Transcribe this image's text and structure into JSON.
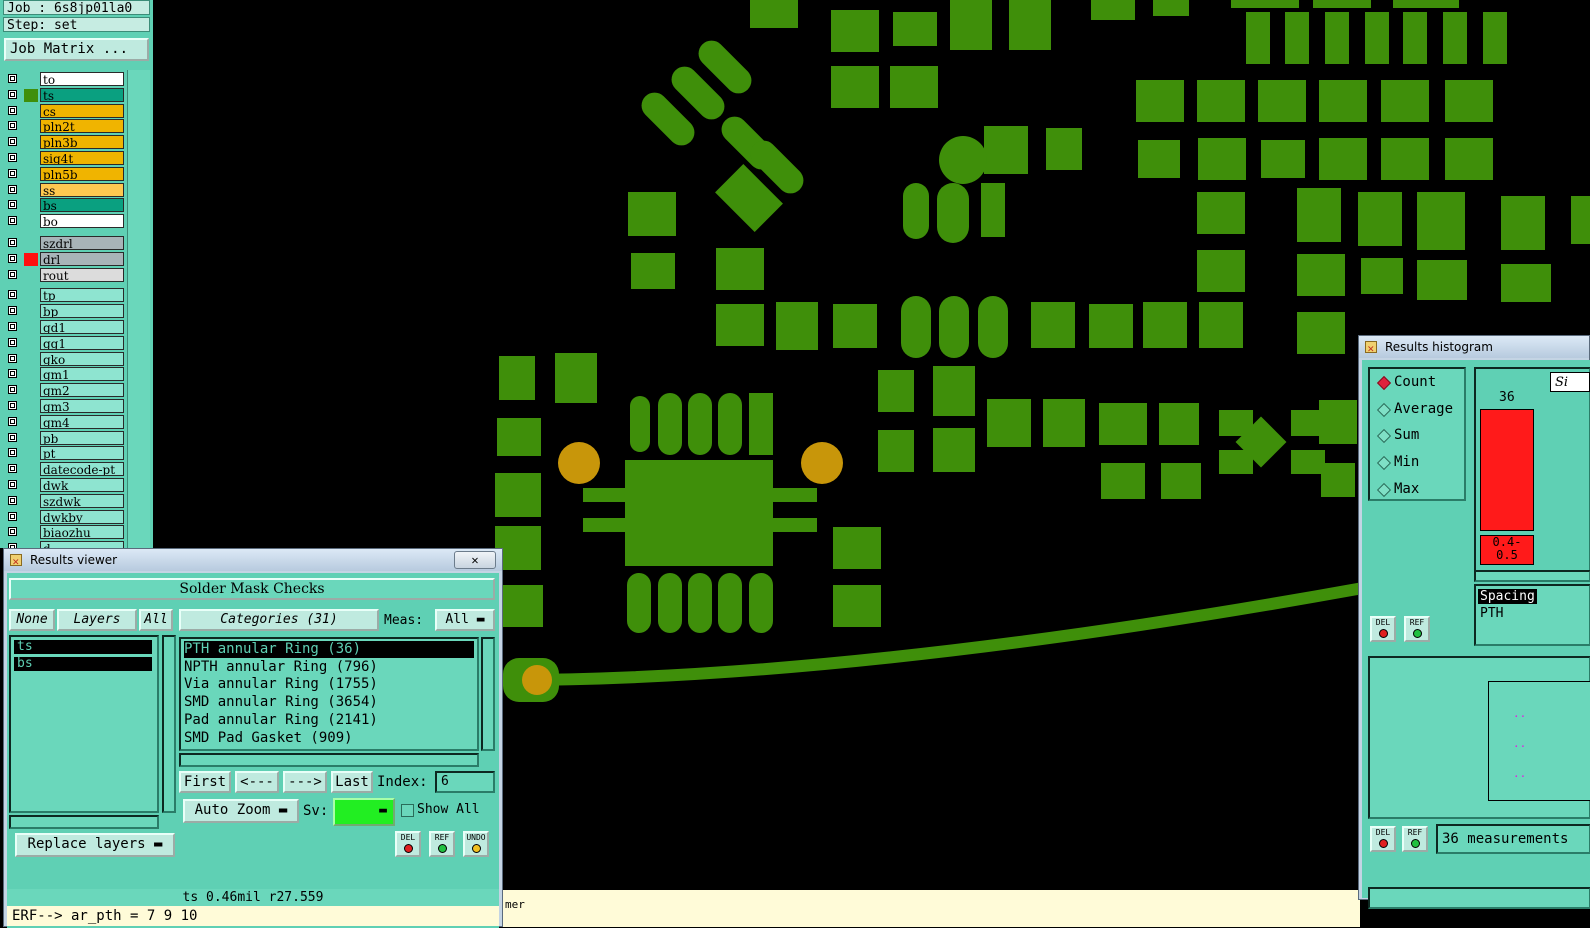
{
  "job": {
    "job_line": "Job : 6s8jp01la0",
    "step_line": "Step: set",
    "matrix_button": "Job Matrix ..."
  },
  "layers": [
    {
      "name": "to",
      "color": "#ffffff"
    },
    {
      "name": "ts",
      "color": "#0aa080",
      "active": true
    },
    {
      "name": "cs",
      "color": "#f0b400"
    },
    {
      "name": "pln2t",
      "color": "#f0b400"
    },
    {
      "name": "pln3b",
      "color": "#f0b400"
    },
    {
      "name": "sig4t",
      "color": "#f0b400"
    },
    {
      "name": "pln5b",
      "color": "#f0b400"
    },
    {
      "name": "ss",
      "color": "#ffc850"
    },
    {
      "name": "bs",
      "color": "#0aa080"
    },
    {
      "name": "bo",
      "color": "#ffffff"
    },
    {
      "name": "szdrl",
      "color": "#a8b4b8"
    },
    {
      "name": "drl",
      "color": "#a8b4b8",
      "swatch": "#ff1010"
    },
    {
      "name": "rout",
      "color": "#dcdcdc"
    },
    {
      "name": "tp",
      "color": "#8ee4d0"
    },
    {
      "name": "bp",
      "color": "#8ee4d0"
    },
    {
      "name": "gd1",
      "color": "#8ee4d0"
    },
    {
      "name": "gg1",
      "color": "#8ee4d0"
    },
    {
      "name": "gko",
      "color": "#8ee4d0"
    },
    {
      "name": "gm1",
      "color": "#8ee4d0"
    },
    {
      "name": "gm2",
      "color": "#8ee4d0"
    },
    {
      "name": "gm3",
      "color": "#8ee4d0"
    },
    {
      "name": "gm4",
      "color": "#8ee4d0"
    },
    {
      "name": "pb",
      "color": "#8ee4d0"
    },
    {
      "name": "pt",
      "color": "#8ee4d0"
    },
    {
      "name": "datecode-pt",
      "color": "#8ee4d0"
    },
    {
      "name": "dwk",
      "color": "#8ee4d0"
    },
    {
      "name": "szdwk",
      "color": "#8ee4d0"
    },
    {
      "name": "dwkby",
      "color": "#8ee4d0"
    },
    {
      "name": "biaozhu",
      "color": "#8ee4d0"
    },
    {
      "name": "d",
      "color": "#8ee4d0"
    }
  ],
  "results_viewer": {
    "title": "Results viewer",
    "close": "✕",
    "header": "Solder Mask Checks",
    "btn_none": "None",
    "btn_layers": "Layers",
    "btn_all": "All",
    "btn_categories": "Categories (31)",
    "meas_label": "Meas:",
    "meas_value": "All",
    "selected_layers": [
      "ts",
      "bs"
    ],
    "categories": [
      "PTH annular Ring (36)",
      "NPTH annular Ring (796)",
      "Via annular Ring (1755)",
      "SMD annular Ring (3654)",
      "Pad annular Ring (2141)",
      "SMD Pad Gasket (909)"
    ],
    "btn_first": "First",
    "btn_prev": "<---",
    "btn_next": "--->",
    "btn_last": "Last",
    "index_label": "Index:",
    "index_value": "6",
    "auto_zoom": "Auto Zoom",
    "sv_label": "Sv:",
    "show_all": "Show All",
    "replace_layers": "Replace layers",
    "icon_del": "DEL",
    "icon_ref": "REF",
    "icon_undo": "UNDO",
    "status": "ts 0.46mil  r27.559",
    "erf": "ERF--> ar_pth = 7 9 10"
  },
  "results_histogram": {
    "title": "Results histogram",
    "modes": [
      "Count",
      "Average",
      "Sum",
      "Min",
      "Max"
    ],
    "selected_mode": "Count",
    "bar_value": "36",
    "bar_range": "0.4- 0.5",
    "tab_label": "Si",
    "list": [
      "Spacing",
      "PTH"
    ],
    "footer": "36 measurements",
    "icon_del": "DEL",
    "icon_ref": "REF"
  },
  "bottom_status": "mer",
  "colors": {
    "copper": "#3f8f0a",
    "drill": "#c8960a",
    "panel": "#5fd0b4",
    "bar": "#ff1a1a"
  }
}
